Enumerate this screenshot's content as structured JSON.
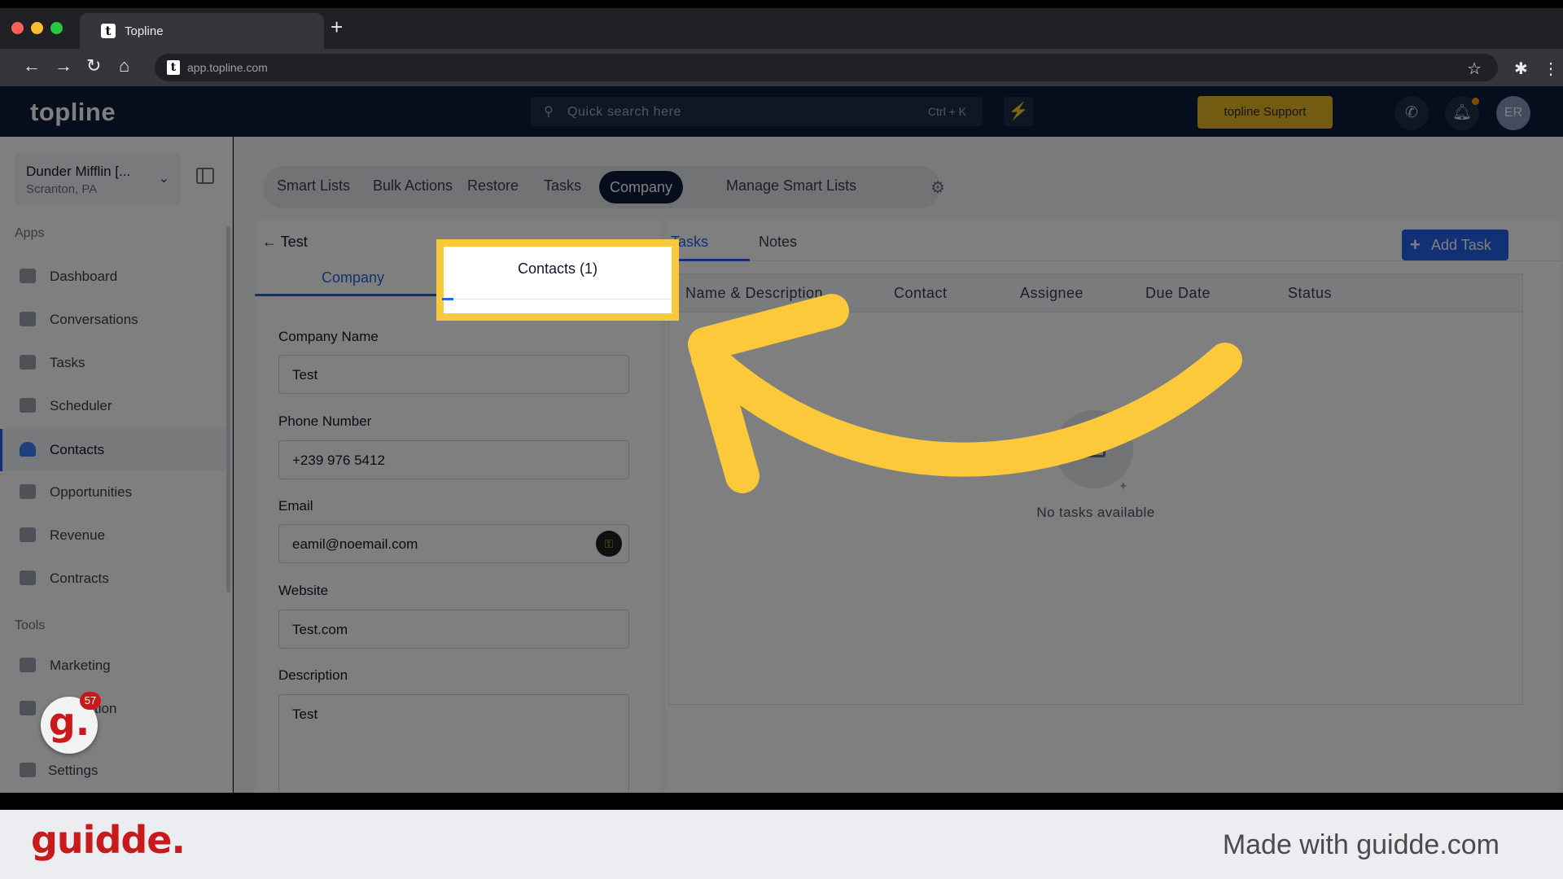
{
  "browser": {
    "tab_title": "Topline",
    "new_tab": "+",
    "url": "app.topline.com",
    "favicon_letter": "t"
  },
  "topnav": {
    "logo": "topline",
    "search_placeholder": "Quick search here",
    "search_shortcut": "Ctrl + K",
    "support_label": "topline Support",
    "avatar_initials": "ER"
  },
  "sidebar": {
    "location_name": "Dunder Mifflin [...",
    "location_sub": "Scranton, PA",
    "apps_heading": "Apps",
    "tools_heading": "Tools",
    "apps": [
      {
        "label": "Dashboard"
      },
      {
        "label": "Conversations"
      },
      {
        "label": "Tasks"
      },
      {
        "label": "Scheduler"
      },
      {
        "label": "Contacts"
      },
      {
        "label": "Opportunities"
      },
      {
        "label": "Revenue"
      },
      {
        "label": "Contracts"
      }
    ],
    "tools": [
      {
        "label": "Marketing"
      },
      {
        "label": "tion"
      },
      {
        "label": "Settings"
      }
    ]
  },
  "segments": {
    "items": [
      "Smart Lists",
      "Bulk Actions",
      "Restore",
      "Tasks",
      "Company",
      "Manage Smart Lists"
    ],
    "active": "Company"
  },
  "company_panel": {
    "back_label": "Test",
    "tab_company": "Company",
    "tab_contacts": "Contacts (1)",
    "fields": {
      "company_name_label": "Company Name",
      "company_name_value": "Test",
      "phone_label": "Phone Number",
      "phone_value": "+239 976 5412",
      "email_label": "Email",
      "email_value": "eamil@noemail.com",
      "website_label": "Website",
      "website_value": "Test.com",
      "description_label": "Description",
      "description_value": "Test"
    }
  },
  "tasks_panel": {
    "tab_tasks": "Tasks",
    "tab_notes": "Notes",
    "add_task": "Add Task",
    "columns": [
      "Name & Description",
      "Contact",
      "Assignee",
      "Due Date",
      "Status"
    ],
    "empty_text": "No tasks available"
  },
  "guidde": {
    "badge_letter": "g.",
    "badge_count": "57",
    "footer_logo": "guidde.",
    "footer_text": "Made with guidde.com"
  },
  "colors": {
    "highlight": "#f9c93c",
    "brand_navy": "#0c1a3a",
    "accent_blue": "#2563eb",
    "guidde_red": "#c81a1a",
    "support_yellow": "#e7b622"
  }
}
